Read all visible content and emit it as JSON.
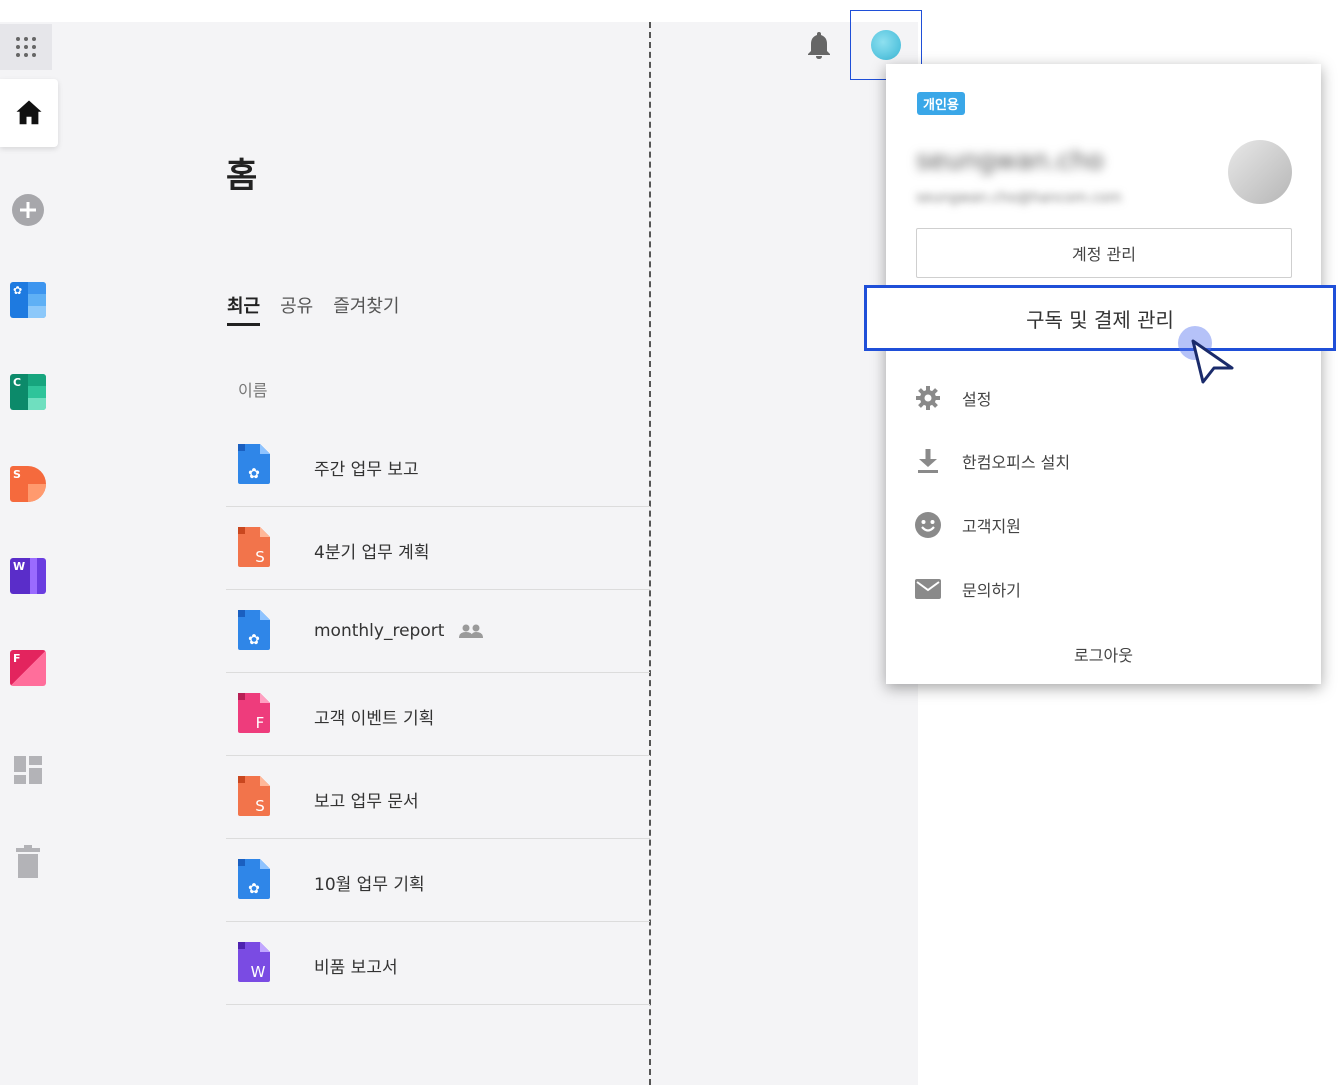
{
  "header": {
    "notifications_icon": "bell-icon",
    "avatar_icon": "avatar-circle"
  },
  "sidebar": {
    "items": [
      {
        "icon": "apps-grid-icon"
      },
      {
        "icon": "home-icon"
      },
      {
        "icon": "add-icon"
      },
      {
        "icon": "hancell-app-icon",
        "letter": "✿"
      },
      {
        "icon": "calc-app-icon",
        "letter": "C"
      },
      {
        "icon": "show-app-icon",
        "letter": "S"
      },
      {
        "icon": "word-app-icon",
        "letter": "W"
      },
      {
        "icon": "form-app-icon",
        "letter": "F"
      },
      {
        "icon": "dashboard-icon"
      },
      {
        "icon": "trash-icon"
      }
    ]
  },
  "main": {
    "title": "홈",
    "tabs": [
      {
        "label": "최근",
        "active": true
      },
      {
        "label": "공유",
        "active": false
      },
      {
        "label": "즐겨찾기",
        "active": false
      }
    ],
    "column_header": "이름",
    "files": [
      {
        "name": "주간 업무 보고",
        "type": "doc",
        "letter": "✿",
        "color": "#2f86e8"
      },
      {
        "name": "4분기 업무 계획",
        "type": "show",
        "letter": "S",
        "color": "#f2744b"
      },
      {
        "name": "monthly_report",
        "type": "doc",
        "letter": "✿",
        "color": "#2f86e8",
        "shared": true
      },
      {
        "name": "고객 이벤트 기획",
        "type": "form",
        "letter": "F",
        "color": "#ee3c7c"
      },
      {
        "name": "보고 업무 문서",
        "type": "show",
        "letter": "S",
        "color": "#f2744b"
      },
      {
        "name": "10월 업무 기획",
        "type": "doc",
        "letter": "✿",
        "color": "#2f86e8"
      },
      {
        "name": "비품 보고서",
        "type": "word",
        "letter": "W",
        "color": "#7a4be3"
      }
    ]
  },
  "account_menu": {
    "badge": "개인용",
    "username": "seungwan.cho",
    "email": "seungwan.cho@hancom.com",
    "manage_account": "계정 관리",
    "subscription": "구독 및 결제 관리",
    "items": [
      {
        "label": "설정",
        "icon": "gear-icon"
      },
      {
        "label": "한컴오피스 설치",
        "icon": "download-icon"
      },
      {
        "label": "고객지원",
        "icon": "smiley-icon"
      },
      {
        "label": "문의하기",
        "icon": "mail-icon"
      }
    ],
    "logout": "로그아웃"
  },
  "colors": {
    "highlight": "#1f4fd8",
    "badge": "#3aa7e8"
  }
}
